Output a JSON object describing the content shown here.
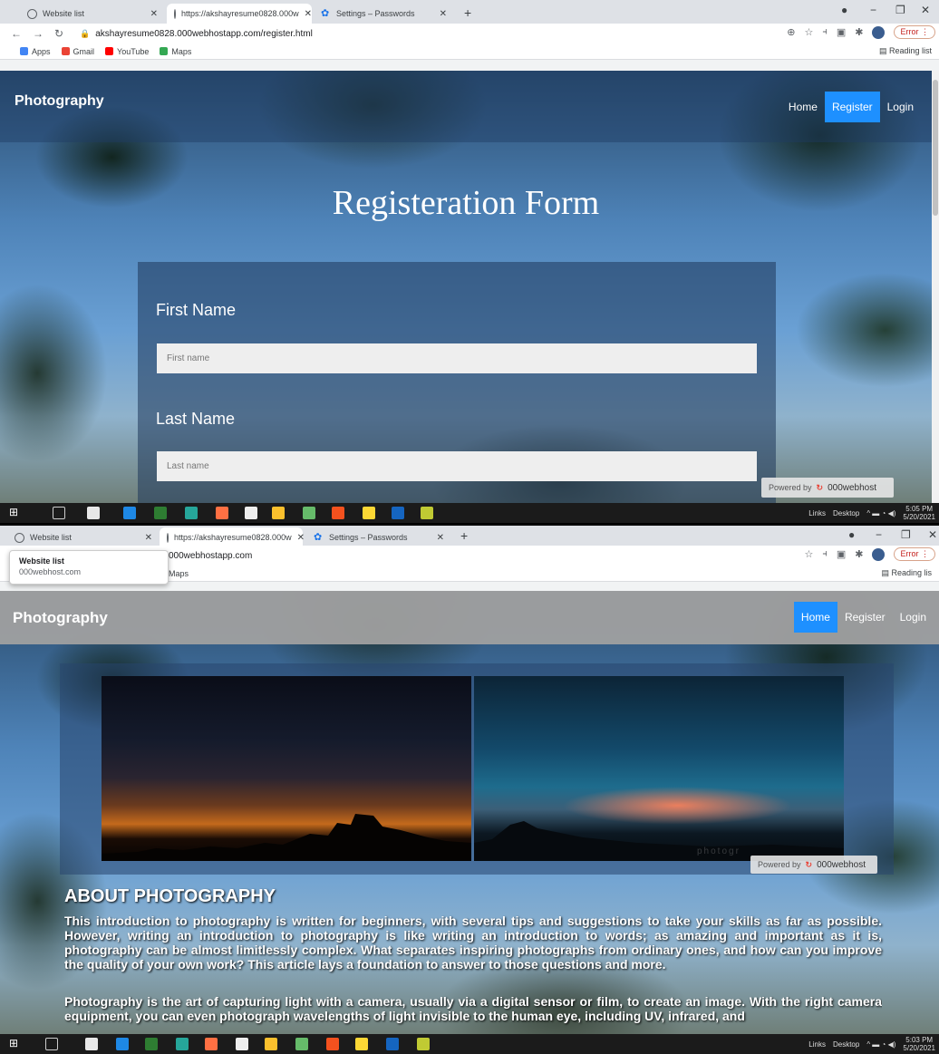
{
  "screen1": {
    "tabs": [
      {
        "label": "Website list"
      },
      {
        "label": "https://akshayresume0828.000w"
      },
      {
        "label": "Settings – Passwords"
      }
    ],
    "url": "akshayresume0828.000webhostapp.com/register.html",
    "error_label": "Error",
    "bookmarks": [
      "Apps",
      "Gmail",
      "YouTube",
      "Maps"
    ],
    "reading_list": "Reading list",
    "brand": "Photography",
    "nav": [
      "Home",
      "Register",
      "Login"
    ],
    "form_title": "Registeration Form",
    "first_name_label": "First Name",
    "first_name_placeholder": "First name",
    "last_name_label": "Last Name",
    "last_name_placeholder": "Last name",
    "powered_by": "Powered by",
    "host_brand": "000webhost",
    "taskbar": {
      "links": "Links",
      "desktop": "Desktop",
      "time": "5:05 PM",
      "date": "5/20/2021"
    }
  },
  "screen2": {
    "tabs": [
      {
        "label": "Website list"
      },
      {
        "label": "https://akshayresume0828.000w"
      },
      {
        "label": "Settings – Passwords"
      }
    ],
    "tooltip_title": "Website list",
    "tooltip_sub": "000webhost.com",
    "url_fragment": "000webhostapp.com",
    "bookmark_fragment": "Maps",
    "error_label": "Error",
    "reading_list": "Reading lis",
    "brand": "Photography",
    "nav": [
      "Home",
      "Register",
      "Login"
    ],
    "watermark": "photogr",
    "powered_by": "Powered by",
    "host_brand": "000webhost",
    "about_title": "ABOUT PHOTOGRAPHY",
    "about_p1": "This introduction to photography is written for beginners, with several tips and suggestions to take your skills as far as possible. However, writing an introduction to photography is like writing an introduction to words; as amazing and important as it is, photography can be almost limitlessly complex. What separates inspiring photographs from ordinary ones, and how can you improve the quality of your own work? This article lays a foundation to answer to those questions and more.",
    "about_p2": "Photography is the art of capturing light with a camera, usually via a digital sensor or film, to create an image. With the right camera equipment, you can even photograph wavelengths of light invisible to the human eye, including UV, infrared, and",
    "taskbar": {
      "links": "Links",
      "desktop": "Desktop",
      "time": "5:03 PM",
      "date": "5/20/2021"
    }
  },
  "colors": {
    "accent": "#1e90ff",
    "tab_bg": "#dee1e6",
    "taskbar": "#1b1b1b"
  }
}
